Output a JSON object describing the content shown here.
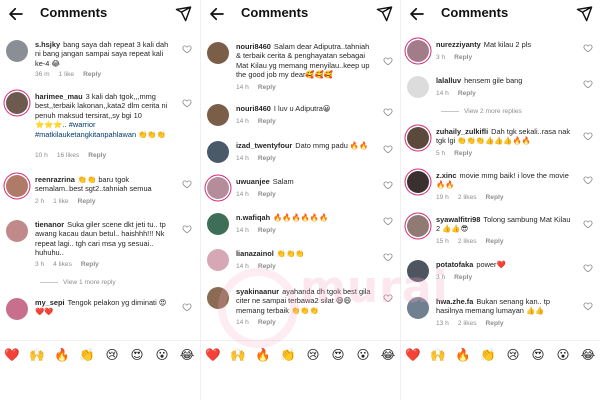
{
  "header": {
    "title": "Comments"
  },
  "colors": {
    "link": "#00376b",
    "meta": "#8e8e8e",
    "story_ring": "#d62976"
  },
  "watermark": "murai",
  "emoji_bar": [
    "❤️",
    "🙌",
    "🔥",
    "👏",
    "😢",
    "😍",
    "😮",
    "😂"
  ],
  "panels": [
    {
      "comments": [
        {
          "username": "s.hsjky",
          "text": "bang saya dah repeat 3 kali dah ni bang jangan sampai saya repeat kali ke-4 😂",
          "time": "36 m",
          "likes": "1 like",
          "reply": "Reply"
        },
        {
          "username": "harimee_mau",
          "text": "3 kali dah tgok,,,mmg best,,terbaik lakonan,,kata2 dlm cerita ni penuh maksud tersirat,,sy bgi 10 ⭐⭐⭐..",
          "hashtag": "#warrior #matkilauketangkitanpahlawan 👏👏👏",
          "time": "10 h",
          "likes": "16 likes",
          "reply": "Reply"
        },
        {
          "username": "reenrazrina",
          "text": "👏👏 baru tgok semalam..best sgt2..tahniah semua",
          "time": "2 h",
          "likes": "1 like",
          "reply": "Reply"
        },
        {
          "username": "tienanor",
          "text": "Suka giler scene dkt jeti tu.. tp awang kacau daun betul.. haishhh!!! Nk repeat lagi.. tgh cari msa yg sesuai.. huhuhu..",
          "time": "3 h",
          "likes": "4 likes",
          "reply": "Reply",
          "view_replies": "View 1 more reply"
        },
        {
          "username": "my_sepi",
          "text": "Tengok pelakon yg diminati 😍❤️❤️",
          "time": "",
          "likes": "",
          "reply": ""
        }
      ]
    },
    {
      "comments": [
        {
          "username": "nouri8460",
          "text": "Salam dear Adiputra..tahniah & terbaik cerita & penghayatan sebagai Mat Kilau yg memang menyilau..keep up the good job my dear🥰🥰🥰",
          "time": "14 h",
          "likes": "",
          "reply": "Reply"
        },
        {
          "username": "nouri8460",
          "text": "I luv u Adiputra😀",
          "time": "14 h",
          "likes": "",
          "reply": "Reply"
        },
        {
          "username": "izad_twentyfour",
          "text": "Dato mmg padu 🔥🔥",
          "time": "14 h",
          "likes": "",
          "reply": "Reply"
        },
        {
          "username": "uwuanjee",
          "text": "Salam",
          "time": "14 h",
          "likes": "",
          "reply": "Reply"
        },
        {
          "username": "n.wafiqah",
          "text": "🔥🔥🔥🔥🔥🔥",
          "time": "14 h",
          "likes": "",
          "reply": "Reply"
        },
        {
          "username": "lianazainol",
          "text": "👏👏👏",
          "time": "14 h",
          "likes": "",
          "reply": "Reply"
        },
        {
          "username": "syakinaanur",
          "text": "ayahanda dh tgok best gila citer ne sampai terbawa2 silat 😄😄 memang terbaik 👏👏👏",
          "time": "14 h",
          "likes": "",
          "reply": "Reply"
        }
      ]
    },
    {
      "comments": [
        {
          "username": "nurezziyanty",
          "text": "Mat kilau 2 pls",
          "time": "3 h",
          "likes": "",
          "reply": "Reply"
        },
        {
          "username": "lalalluv",
          "text": "hensem gile bang",
          "time": "14 h",
          "likes": "",
          "reply": "Reply",
          "view_replies": "View 2 more replies"
        },
        {
          "username": "zuhaily_zulkifli",
          "text": "Dah tgk sekali..rasa nak tgk lgi 👏👏👏👍👍👍🔥🔥",
          "time": "5 h",
          "likes": "",
          "reply": "Reply"
        },
        {
          "username": "z.xinc",
          "text": "movie mmg baik! i love the movie 🔥🔥",
          "time": "19 h",
          "likes": "2 likes",
          "reply": "Reply"
        },
        {
          "username": "syawalfitri98",
          "text": "Tolong sambung Mat Kilau 2 👍👍😎",
          "time": "15 h",
          "likes": "2 likes",
          "reply": "Reply"
        },
        {
          "username": "potatofaka",
          "text": "power❤️",
          "time": "3 h",
          "likes": "",
          "reply": "Reply"
        },
        {
          "username": "hwa.zhe.fa",
          "text": "Bukan senang kan.. tp hasilnya memang lumayan 👍👍",
          "time": "13 h",
          "likes": "2 likes",
          "reply": "Reply"
        }
      ]
    }
  ]
}
